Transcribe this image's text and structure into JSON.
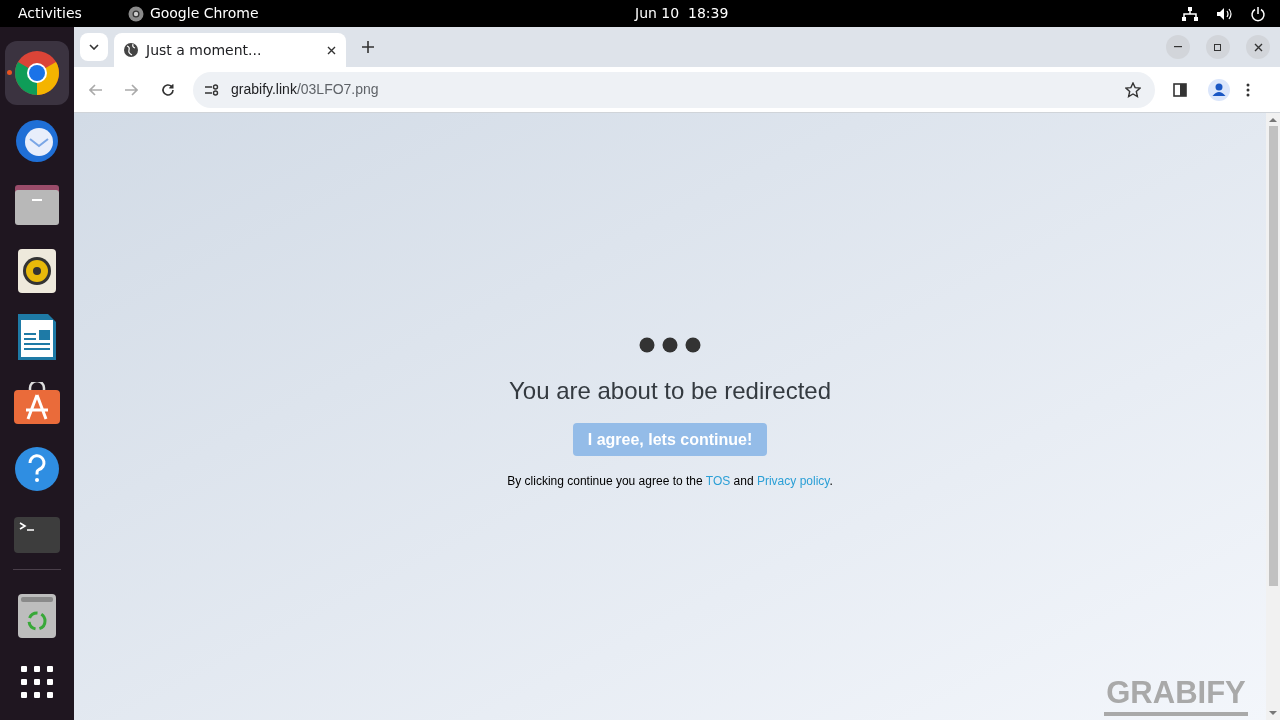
{
  "top_bar": {
    "activities": "Activities",
    "app_name": "Google Chrome",
    "clock": "Jun 10  18:39"
  },
  "dock": {
    "items": [
      {
        "kind": "chrome",
        "running": true
      },
      {
        "kind": "mail",
        "running": false
      },
      {
        "kind": "files",
        "running": false
      },
      {
        "kind": "speaker",
        "running": false
      },
      {
        "kind": "writer",
        "running": false
      },
      {
        "kind": "store",
        "running": false
      },
      {
        "kind": "help",
        "running": false
      },
      {
        "kind": "terminal",
        "running": false
      },
      {
        "kind": "trash",
        "running": false
      },
      {
        "kind": "apps",
        "running": false
      }
    ]
  },
  "browser": {
    "tabs": [
      {
        "title": "Just a moment...",
        "selected": true
      }
    ],
    "address": {
      "host": "grabify.link",
      "path": "/03LFO7.png"
    }
  },
  "page": {
    "heading": "You are about to be redirected",
    "button": "I agree, lets continue!",
    "consent": {
      "before": "By clicking continue you agree to the",
      "tos": "TOS",
      "middle": "and",
      "privacy": "Privacy policy",
      "after": "."
    },
    "logo": "GRABIFY"
  }
}
